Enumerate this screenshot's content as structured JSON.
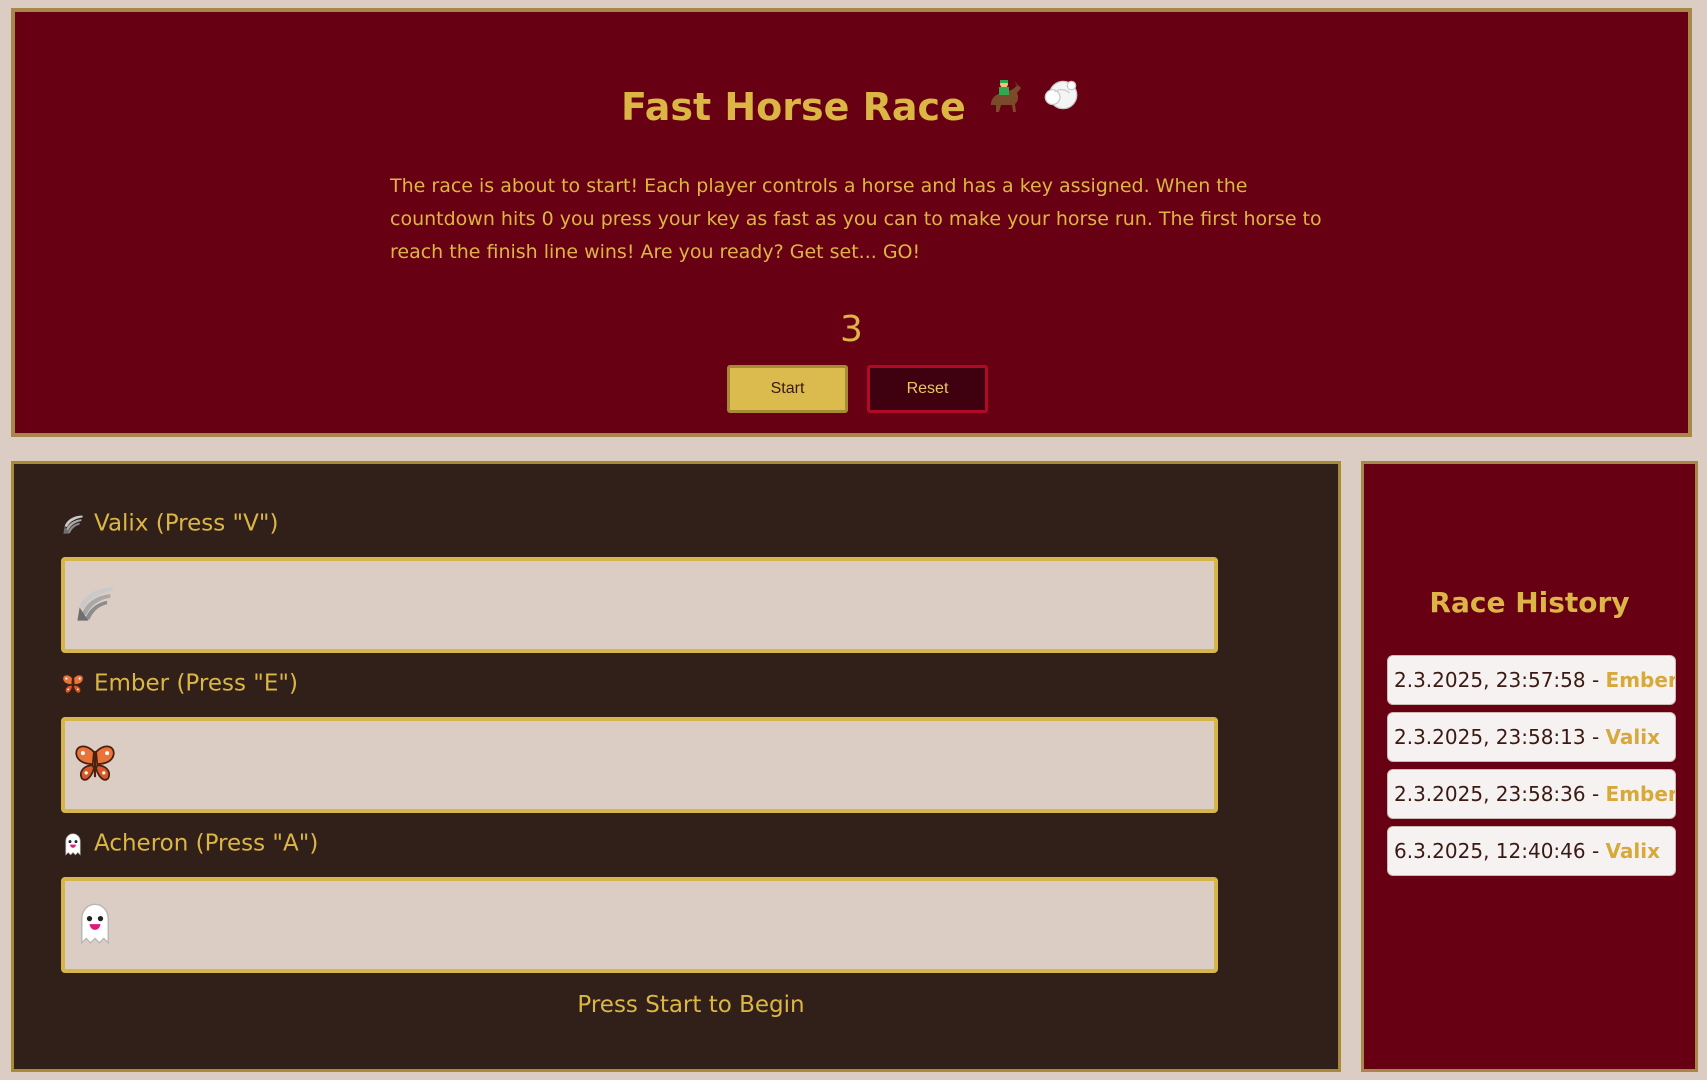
{
  "header": {
    "title": "Fast Horse Race",
    "title_icons": [
      "horse-racing-icon",
      "dash-cloud-icon"
    ],
    "description": "The race is about to start! Each player controls a horse and has a key assigned. When the countdown hits 0 you press your key as fast as you can to make your horse run. The first horse to reach the finish line wins! Are you ready? Get set... GO!",
    "countdown": "3",
    "start_label": "Start",
    "reset_label": "Reset"
  },
  "race": {
    "racers": [
      {
        "label": "Valix (Press \"V\")",
        "icon": "wing-icon",
        "progress": 0
      },
      {
        "label": "Ember (Press \"E\")",
        "icon": "butterfly-icon",
        "progress": 0
      },
      {
        "label": "Acheron (Press \"A\")",
        "icon": "ghost-icon",
        "progress": 0
      }
    ],
    "status": "Press Start to Begin"
  },
  "history": {
    "title": "Race History",
    "entries": [
      {
        "time": "2.3.2025, 23:57:58",
        "sep": " - ",
        "winner": "Ember"
      },
      {
        "time": "2.3.2025, 23:58:13",
        "sep": " - ",
        "winner": "Valix"
      },
      {
        "time": "2.3.2025, 23:58:36",
        "sep": " - ",
        "winner": "Ember"
      },
      {
        "time": "6.3.2025, 12:40:46",
        "sep": " - ",
        "winner": "Valix"
      }
    ]
  },
  "colors": {
    "background": "#dbcdc3",
    "header_bg": "#670013",
    "race_bg": "#31201a",
    "accent": "#dcb644",
    "reset_border": "#b10928"
  }
}
